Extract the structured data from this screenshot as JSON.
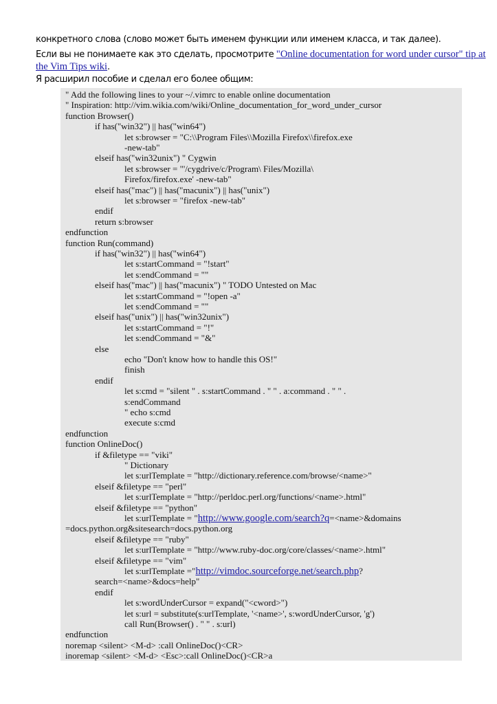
{
  "intro": {
    "line1": "конкретного слова (слово может быть именем функции или именем класса, и так далее).",
    "line2_text": "Если вы не понимаете как это сделать, просмотрите ",
    "line2_link": "\"Online documentation for word under cursor\" tip at",
    "line3_link": "the Vim Tips wiki",
    "line3_after": ".",
    "line4": "Я расширил пособие и сделал его более общим:"
  },
  "code_lines": [
    "\" Add the following lines to your ~/.vimrc to enable online documentation",
    "\" Inspiration: http://vim.wikia.com/wiki/Online_documentation_for_word_under_cursor",
    "function Browser()",
    "if has(\"win32\") || has(\"win64\")",
    "let s:browser = \"C:\\\\Program Files\\\\Mozilla Firefox\\\\firefox.exe",
    "-new-tab\"",
    "elseif has(\"win32unix\") \" Cygwin",
    "let s:browser = \"'/cygdrive/c/Program\\ Files/Mozilla\\",
    "Firefox/firefox.exe' -new-tab\"",
    "elseif has(\"mac\") || has(\"macunix\") || has(\"unix\")",
    "let s:browser = \"firefox -new-tab\"",
    "endif",
    "return s:browser",
    "endfunction",
    "function Run(command)",
    "if has(\"win32\") || has(\"win64\")",
    "let s:startCommand = \"!start\"",
    "let s:endCommand = \"\"",
    "elseif has(\"mac\") || has(\"macunix\") \" TODO Untested on Mac",
    "let s:startCommand = \"!open -a\"",
    "let s:endCommand = \"\"",
    "elseif has(\"unix\") || has(\"win32unix\")",
    "let s:startCommand = \"!\"",
    "let s:endCommand = \"&\"",
    "else",
    "echo \"Don't know how to handle this OS!\"",
    "finish",
    "endif",
    "let s:cmd = \"silent \" . s:startCommand . \" \" . a:command . \" \" .",
    "s:endCommand",
    "\" echo s:cmd",
    "execute s:cmd",
    "endfunction",
    "function OnlineDoc()",
    "if &filetype == \"viki\"",
    "\" Dictionary",
    "let s:urlTemplate = \"http://dictionary.reference.com/browse/<name>\"",
    "elseif &filetype == \"perl\"",
    "let s:urlTemplate = \"http://perldoc.perl.org/functions/<name>.html\"",
    "elseif &filetype == \"python\"",
    "let s:urlTemplate = \"",
    "=docs.python.org&sitesearch=docs.python.org",
    "elseif &filetype == \"ruby\"",
    "let s:urlTemplate = \"http://www.ruby-doc.org/core/classes/<name>.html\"",
    "elseif &filetype == \"vim\"",
    "let s:urlTemplate =\"",
    "search=<name>&docs=help\"",
    "endif",
    "let s:wordUnderCursor = expand(\"<cword>\")",
    "let s:url = substitute(s:urlTemplate, '<name>', s:wordUnderCursor, 'g')",
    "call Run(Browser() . \" \" . s:url)",
    "endfunction",
    "noremap <silent> <M-d> :call OnlineDoc()<CR>",
    "inoremap <silent> <M-d> <Esc>:call OnlineDoc()<CR>a"
  ],
  "code_links": {
    "python_link": "http://www.google.com/search?q",
    "python_after": "=<name>&domains",
    "vim_link": "http://vimdoc.sourceforge.net/search.php",
    "vim_after": "?"
  }
}
